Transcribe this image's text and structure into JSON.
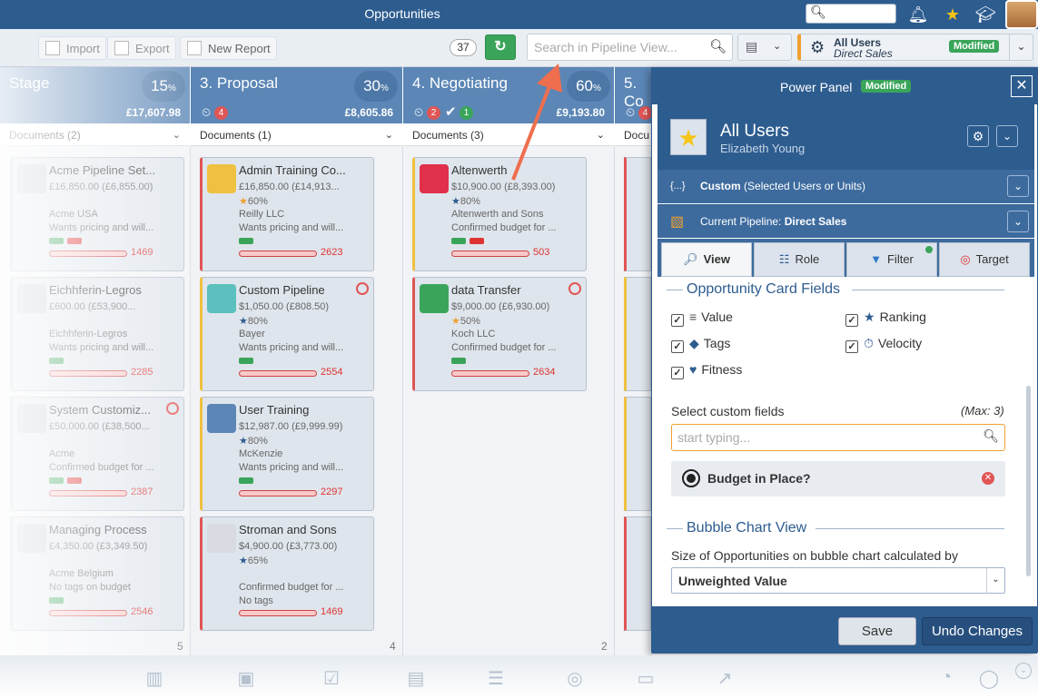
{
  "header": {
    "title": "Opportunities"
  },
  "toolbar": {
    "import_label": "Import",
    "export_label": "Export",
    "new_report_label": "New Report",
    "count": "37",
    "search_placeholder": "Search in Pipeline View...",
    "user_selector": {
      "name": "All Users",
      "pipeline": "Direct Sales",
      "badge": "Modified"
    }
  },
  "columns": [
    {
      "title": "Stage",
      "percent": "15",
      "amount": "£17,607.98",
      "docs": "Documents (2)",
      "count": "5"
    },
    {
      "title": "3. Proposal",
      "percent": "30",
      "amount": "£8,605.86",
      "stuck": "4",
      "docs": "Documents (1)",
      "count": "4"
    },
    {
      "title": "4. Negotiating",
      "percent": "60",
      "amount": "£9,193.80",
      "stuck": "2",
      "won": "1",
      "docs": "Documents (3)",
      "count": "2"
    },
    {
      "title": "5. Co",
      "stuck": "4",
      "docs": "Docu"
    }
  ],
  "col0_cards": [
    {
      "title": "Acme Pipeline Set...",
      "value": "£16,850.00 (£6,855.00)",
      "company": "Acme USA",
      "note": "Wants pricing and will...",
      "num": "1469"
    },
    {
      "title": "Eichhferin-Legros",
      "value": "£600.00 (£53,900...",
      "company": "Eichhferin-Legros",
      "note": "Wants pricing and will...",
      "num": "2285"
    },
    {
      "title": "System Customiz...",
      "value": "£50,000.00 (£38,500...",
      "company": "Acme",
      "note": "Confirmed budget for ...",
      "num": "2387"
    },
    {
      "title": "Managing Process",
      "value": "£4,350.00 (£3,349.50)",
      "company": "Acme Belgium",
      "note": "No tags on budget",
      "num": "2546"
    }
  ],
  "col1_cards": [
    {
      "title": "Admin Training Co...",
      "value": "£16,850.00 (£14,913...",
      "prob": "60%",
      "company": "Reilly LLC",
      "note": "Wants pricing and will...",
      "num": "2623"
    },
    {
      "title": "Custom Pipeline",
      "value": "$1,050.00 (£808.50)",
      "prob": "80%",
      "company": "Bayer",
      "note": "Wants pricing and will...",
      "num": "2554"
    },
    {
      "title": "User Training",
      "value": "$12,987.00 (£9,999.99)",
      "prob": "80%",
      "company": "McKenzie",
      "note": "Wants pricing and will...",
      "num": "2297"
    },
    {
      "title": "Stroman and Sons",
      "value": "$4,900.00 (£3,773.00)",
      "prob": "65%",
      "company": "",
      "note": "Confirmed budget for ...",
      "note2": "No tags",
      "num": "1469"
    }
  ],
  "col2_cards": [
    {
      "title": "Altenwerth",
      "value": "$10,900.00 (£8,393.00)",
      "prob": "80%",
      "company": "Altenwerth and Sons",
      "note": "Confirmed budget for ...",
      "num": "503"
    },
    {
      "title": "data Transfer",
      "value": "$9,000.00 (£6,930.00)",
      "prob": "50%",
      "company": "Koch LLC",
      "note": "Confirmed budget for ...",
      "num": "2634"
    }
  ],
  "power_panel": {
    "title": "Power Panel",
    "badge": "Modified",
    "user_name": "All Users",
    "user_sub": "Elizabeth Young",
    "custom_label": "Custom",
    "custom_detail": "(Selected Users or Units)",
    "pipeline_label": "Current Pipeline:",
    "pipeline_value": "Direct Sales",
    "tabs": [
      "View",
      "Role",
      "Filter",
      "Target"
    ],
    "card_fields_title": "Opportunity Card Fields",
    "fields": [
      "Value",
      "Ranking",
      "Tags",
      "Velocity",
      "Fitness"
    ],
    "custom_fields_label": "Select custom fields",
    "custom_fields_max": "(Max: 3)",
    "custom_fields_placeholder": "start typing...",
    "selected_field": "Budget in Place?",
    "bubble_title": "Bubble Chart View",
    "bubble_label": "Size of Opportunities on bubble chart calculated by",
    "bubble_value": "Unweighted Value",
    "save_label": "Save",
    "undo_label": "Undo Changes"
  },
  "colors": {
    "header": "#2d5c8f",
    "column": "#5b86b6",
    "green": "#3aa55a",
    "red": "#e05555",
    "arrow": "#ef6e4e"
  }
}
